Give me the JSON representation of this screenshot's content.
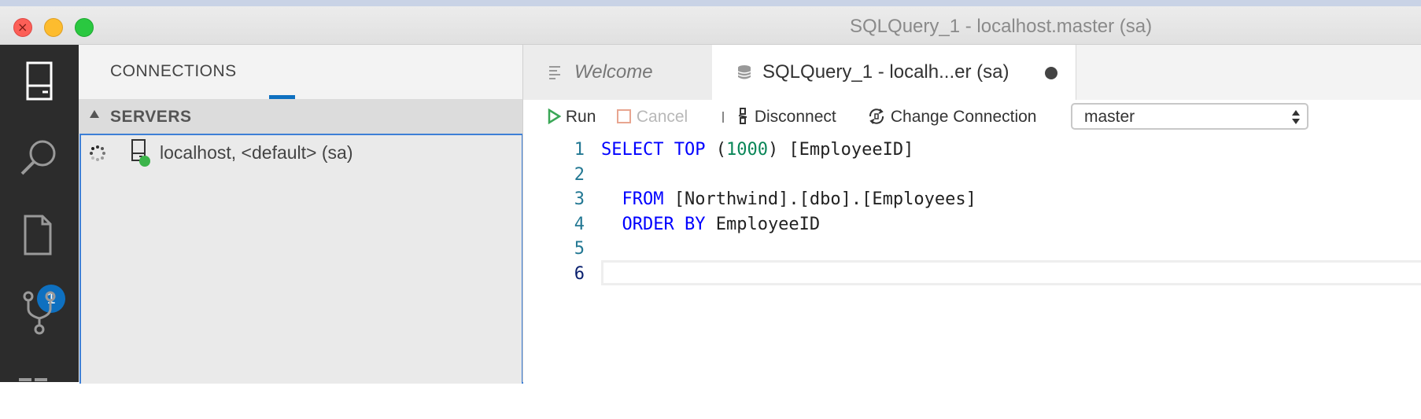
{
  "window": {
    "title": "SQLQuery_1 - localhost.master (sa)"
  },
  "activity_bar": {
    "badge_count": "1"
  },
  "sidebar": {
    "header": "CONNECTIONS",
    "section": "SERVERS",
    "servers": [
      {
        "label": "localhost, <default> (sa)"
      }
    ]
  },
  "tabs": [
    {
      "label": "Welcome"
    },
    {
      "label": "SQLQuery_1 - localh...er (sa)"
    }
  ],
  "toolbar": {
    "run": "Run",
    "cancel": "Cancel",
    "disconnect": "Disconnect",
    "change_connection": "Change Connection",
    "database": "master"
  },
  "editor": {
    "line_numbers": [
      "1",
      "2",
      "3",
      "4",
      "5",
      "6"
    ],
    "lines": [
      [
        {
          "t": "SELECT TOP",
          "c": "kw"
        },
        {
          "t": " (",
          "c": ""
        },
        {
          "t": "1000",
          "c": "num"
        },
        {
          "t": ") [EmployeeID]",
          "c": ""
        }
      ],
      [],
      [
        {
          "t": "  ",
          "c": ""
        },
        {
          "t": "FROM",
          "c": "kw"
        },
        {
          "t": " [Northwind].[dbo].[Employees]",
          "c": ""
        }
      ],
      [
        {
          "t": "  ",
          "c": ""
        },
        {
          "t": "ORDER BY",
          "c": "kw"
        },
        {
          "t": " EmployeeID",
          "c": ""
        }
      ],
      [],
      []
    ],
    "active_line": 6
  },
  "colors": {
    "accent": "#0e70c0",
    "run_green": "#3aa757",
    "keyword": "#0000ff",
    "number": "#098658",
    "status_green": "#3bb44a"
  }
}
